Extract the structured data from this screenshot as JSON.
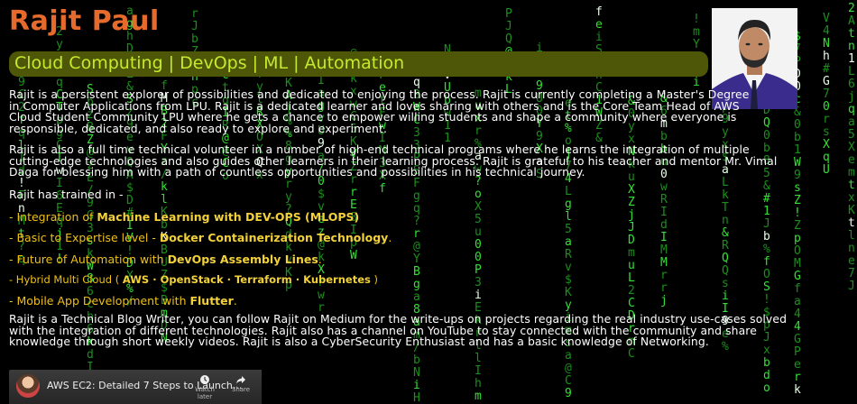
{
  "profile": {
    "name": "Rajit Paul",
    "tagline": "Cloud Computing | DevOps | ML | Automation",
    "photo_alt": "Rajit Paul portrait"
  },
  "about": {
    "p1": "Rajit is a persistent explorer of possibilities and dedicated to enjoying the process. Rajit is currently completing a Master's Degree in Computer Applications from LPU. Rajit is a dedicated learner and loves sharing with others and is the Core Team Head of AWS Cloud Student Community LPU where he gets a chance to empower willing students and shape a community where everyone is responsible, dedicated, and also ready to explore and experiment.",
    "p2": "Rajit is also a full time technical volunteer in a number of high-end technical programs where he learns the integration of multiple cutting-edge technologies and also guides other learners in their learning process. Rajit is grateful to his teacher and mentor Mr. Vimal Daga for blessing him with a path of countless opportunities and possibilities in his technical journey.",
    "trained_heading": "Rajit has trained in -",
    "p3": "Rajit is a Technical Blog Writer, you can follow Rajit on Medium for the write-ups on projects regarding the real industry use-cases solved with the integration of different technologies. Rajit also has a channel on YouTube to stay connected with the community and share knowledge through short weekly videos. Rajit is also a CyberSecurity Enthusiast and has a basic knowledge of Networking."
  },
  "skills": [
    {
      "prefix": "- Integration of ",
      "bold": "Machine Learning with DEV-OPS (MLOPS)",
      "suffix": ""
    },
    {
      "prefix": "- Basic to Expertise level - ",
      "bold": "Docker Containerization Technology",
      "suffix": "."
    },
    {
      "prefix": "- Future of Automation with ",
      "bold": "DevOps Assembly Lines",
      "suffix": "."
    },
    {
      "prefix": "- Hybrid Multi Cloud ( ",
      "bold": "AWS · OpenStack · Terraform · Kubernetes",
      "suffix": " )"
    },
    {
      "prefix": "- Mobile App Development with ",
      "bold": "Flutter",
      "suffix": "."
    }
  ],
  "video": {
    "title": "AWS EC2: Detailed 7 Steps to Launch...",
    "watch_later": "Watch later",
    "share": "Share"
  },
  "colors": {
    "name": "#e56a2c",
    "tagline_bg": "#4e5608",
    "tagline_text": "#c5ea2c",
    "skills": "#f0c016",
    "matrix": "#2fd62f"
  }
}
